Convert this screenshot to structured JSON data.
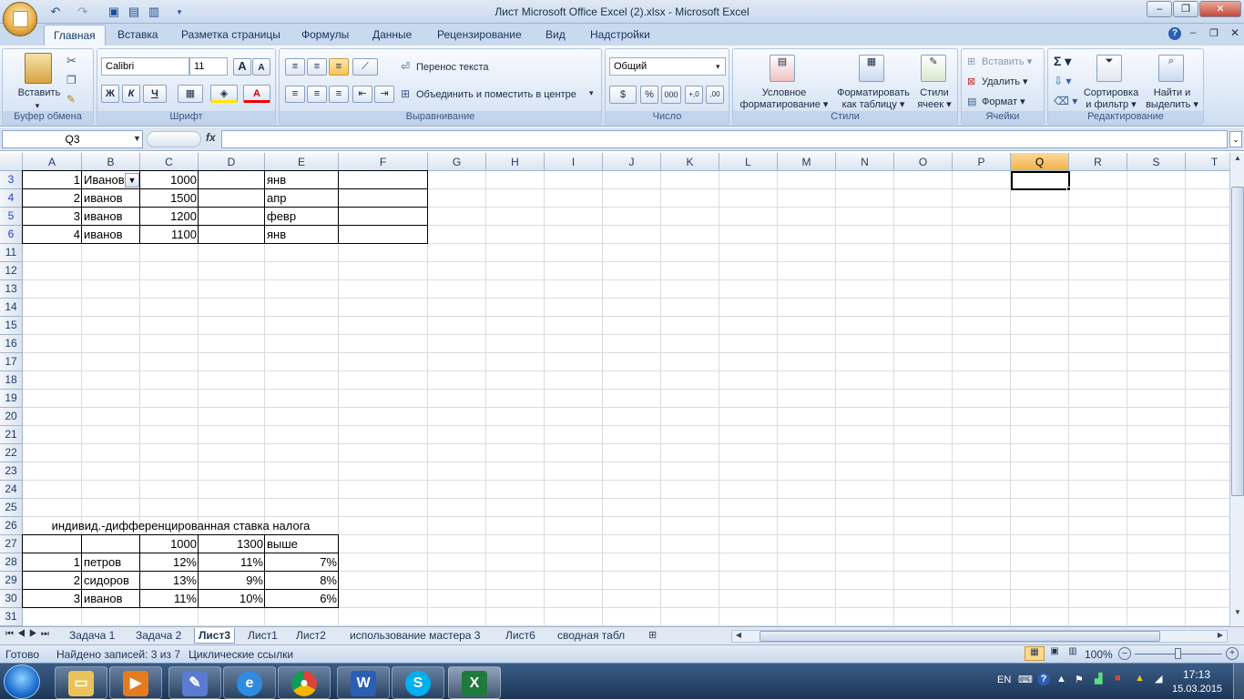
{
  "window": {
    "title": "Лист Microsoft Office Excel (2).xlsx - Microsoft Excel"
  },
  "ribbon": {
    "tabs": [
      "Главная",
      "Вставка",
      "Разметка страницы",
      "Формулы",
      "Данные",
      "Рецензирование",
      "Вид",
      "Надстройки"
    ],
    "clipboard": {
      "paste": "Вставить",
      "label": "Буфер обмена"
    },
    "font": {
      "name": "Calibri",
      "size": "11",
      "bold": "Ж",
      "italic": "К",
      "underline": "Ч",
      "label": "Шрифт"
    },
    "alignment": {
      "wrap": "Перенос текста",
      "merge": "Объединить и поместить в центре",
      "label": "Выравнивание"
    },
    "number": {
      "format": "Общий",
      "percent": "%",
      "thousands": "000",
      "label": "Число"
    },
    "styles": {
      "conditional1": "Условное",
      "conditional2": "форматирование",
      "table1": "Форматировать",
      "table2": "как таблицу",
      "cell1": "Стили",
      "cell2": "ячеек",
      "label": "Стили"
    },
    "cells": {
      "insert": "Вставить",
      "delete": "Удалить",
      "format": "Формат",
      "label": "Ячейки"
    },
    "editing": {
      "sort1": "Сортировка",
      "sort2": "и фильтр",
      "find1": "Найти и",
      "find2": "выделить",
      "label": "Редактирование"
    }
  },
  "formula_bar": {
    "name_box": "Q3",
    "fx": "fx",
    "value": ""
  },
  "columns": [
    "A",
    "B",
    "C",
    "D",
    "E",
    "F",
    "G",
    "H",
    "I",
    "J",
    "K",
    "L",
    "M",
    "N",
    "O",
    "P",
    "Q",
    "R",
    "S",
    "T"
  ],
  "rows": [
    "3",
    "4",
    "5",
    "6",
    "11",
    "12",
    "13",
    "14",
    "15",
    "16",
    "17",
    "18",
    "19",
    "20",
    "21",
    "22",
    "23",
    "24",
    "25",
    "26",
    "27",
    "28",
    "29",
    "30",
    "31"
  ],
  "table1": [
    [
      "1",
      "Иванов",
      "1000",
      "",
      "янв",
      ""
    ],
    [
      "2",
      "иванов",
      "1500",
      "",
      "апр",
      ""
    ],
    [
      "3",
      "иванов",
      "1200",
      "",
      "февр",
      ""
    ],
    [
      "4",
      "иванов",
      "1100",
      "",
      "янв",
      ""
    ]
  ],
  "table2_title": "индивид.-дифференцированная ставка налога",
  "table2": [
    [
      "",
      "",
      "1000",
      "1300",
      "выше"
    ],
    [
      "1",
      "петров",
      "12%",
      "11%",
      "7%"
    ],
    [
      "2",
      "сидоров",
      "13%",
      "9%",
      "8%"
    ],
    [
      "3",
      "иванов",
      "11%",
      "10%",
      "6%"
    ]
  ],
  "sheet_tabs": [
    "Задача 1",
    "Задача 2",
    "Лист3",
    "Лист1",
    "Лист2",
    "использование мастера 3",
    "Лист6",
    "сводная табл"
  ],
  "active_sheet": "Лист3",
  "status": {
    "ready": "Готово",
    "found": "Найдено записей: 3 из 7",
    "circular": "Циклические ссылки",
    "zoom": "100%"
  },
  "taskbar": {
    "lang": "EN",
    "time": "17:13",
    "date": "15.03.2015"
  },
  "colors": {
    "selected_header": "#f1b24a",
    "filtered_row": "#1d43d6",
    "ribbon": "#dbe7f5"
  }
}
